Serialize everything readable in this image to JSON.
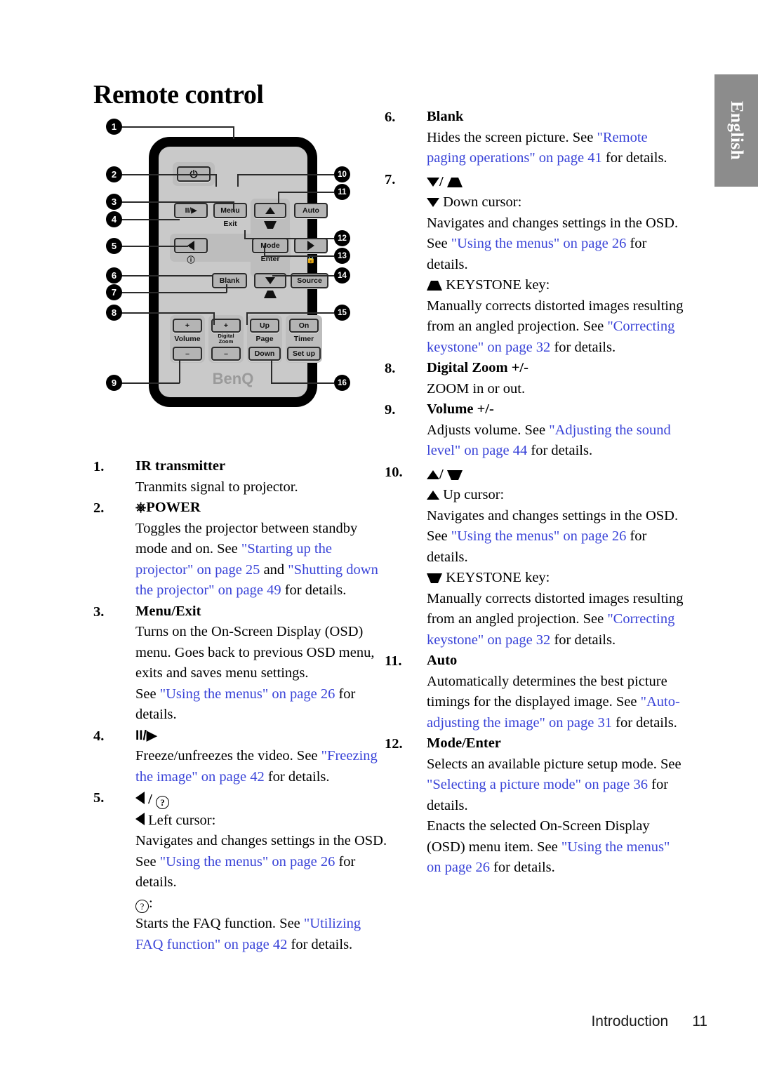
{
  "page": {
    "title": "Remote control",
    "side_tab": "English",
    "footer_section": "Introduction",
    "footer_page": "11",
    "link_color": "#3a44d8",
    "tab_color": "#8c8c8c"
  },
  "remote_diagram": {
    "brand": "BenQ",
    "keys": {
      "power": "⏻",
      "freeze": "II/▶",
      "menu": "Menu",
      "menu_sub": "Exit",
      "auto": "Auto",
      "mode": "Mode",
      "mode_sub": "Enter",
      "blank": "Blank",
      "source": "Source",
      "volume_plus": "+",
      "volume_minus": "–",
      "volume_label": "Volume",
      "zoom_plus": "+",
      "zoom_minus": "–",
      "zoom_label_1": "Digital",
      "zoom_label_2": "Zoom",
      "page_up": "Up",
      "page_down": "Down",
      "page_label": "Page",
      "timer_on": "On",
      "timer_setup": "Set up",
      "timer_label": "Timer",
      "help_icon": "?",
      "lock_icon": "lock"
    },
    "callouts": [
      "1",
      "2",
      "3",
      "4",
      "5",
      "6",
      "7",
      "8",
      "9",
      "10",
      "11",
      "12",
      "13",
      "14",
      "15",
      "16"
    ]
  },
  "items": {
    "n1": {
      "num": "1.",
      "head": "IR transmitter",
      "p1": "Tranmits signal to projector."
    },
    "n2": {
      "num": "2.",
      "head": "POWER",
      "p1_a": "Toggles the projector between standby mode and on. See ",
      "p1_l1": "\"Starting up the projector\" on page 25",
      "p1_b": " and ",
      "p1_l2": "\"Shutting down the projector\" on page 49",
      "p1_c": " for details."
    },
    "n3": {
      "num": "3.",
      "head": "Menu/Exit",
      "p1": "Turns on the On-Screen Display (OSD) menu. Goes back to previous OSD menu, exits and saves menu settings.",
      "p2_a": "See ",
      "p2_l": "\"Using the menus\" on page 26",
      "p2_b": " for details."
    },
    "n4": {
      "num": "4.",
      "head": "II/▶",
      "p1_a": "Freeze/unfreezes the video. See ",
      "p1_l": "\"Freezing the image\" on page 42",
      "p1_b": " for details."
    },
    "n5": {
      "num": "5.",
      "head": "◀ / ?",
      "sub1": "Left cursor:",
      "p1_a": "Navigates and changes settings in the OSD. See ",
      "p1_l": "\"Using the menus\" on page 26",
      "p1_b": " for details.",
      "sub2": ":",
      "p2_a": "Starts the FAQ function. See ",
      "p2_l": "\"Utilizing FAQ function\" on page 42",
      "p2_b": " for details."
    },
    "n6": {
      "num": "6.",
      "head": "Blank",
      "p1_a": "Hides the screen picture. See ",
      "p1_l": "\"Remote paging operations\" on page 41",
      "p1_b": " for details."
    },
    "n7": {
      "num": "7.",
      "head": "▼ / keystone-up",
      "sub1": "Down cursor:",
      "p1_a": "Navigates and changes settings in the OSD. See ",
      "p1_l": "\"Using the menus\" on page 26",
      "p1_b": " for details.",
      "sub2": "KEYSTONE key:",
      "p2_a": "Manually corrects distorted images resulting from an angled projection. See ",
      "p2_l": "\"Correcting keystone\" on page 32",
      "p2_b": " for details."
    },
    "n8": {
      "num": "8.",
      "head": "Digital Zoom +/-",
      "p1": "ZOOM in or out."
    },
    "n9": {
      "num": "9.",
      "head": "Volume +/-",
      "p1_a": "Adjusts volume. See ",
      "p1_l": "\"Adjusting the sound level\" on page 44",
      "p1_b": " for details."
    },
    "n10": {
      "num": "10.",
      "head": "▲ / keystone-down",
      "sub1": "Up cursor:",
      "p1_a": "Navigates and changes settings in the OSD. See ",
      "p1_l": "\"Using the menus\" on page 26",
      "p1_b": " for details.",
      "sub2": "KEYSTONE key:",
      "p2_a": "Manually corrects distorted images resulting from an angled projection. See ",
      "p2_l": "\"Correcting keystone\" on page 32",
      "p2_b": " for details."
    },
    "n11": {
      "num": "11.",
      "head": "Auto",
      "p1_a": "Automatically determines the best picture timings for the displayed image. See ",
      "p1_l": "\"Auto-adjusting the image\" on page 31",
      "p1_b": " for details."
    },
    "n12": {
      "num": "12.",
      "head": "Mode/Enter",
      "p1_a": "Selects an available picture setup mode. See ",
      "p1_l": "\"Selecting a picture mode\" on page 36",
      "p1_b": " for details.",
      "p2_a": "Enacts the selected On-Screen Display (OSD) menu item. See ",
      "p2_l": "\"Using the menus\" on page 26",
      "p2_b": " for details."
    }
  }
}
